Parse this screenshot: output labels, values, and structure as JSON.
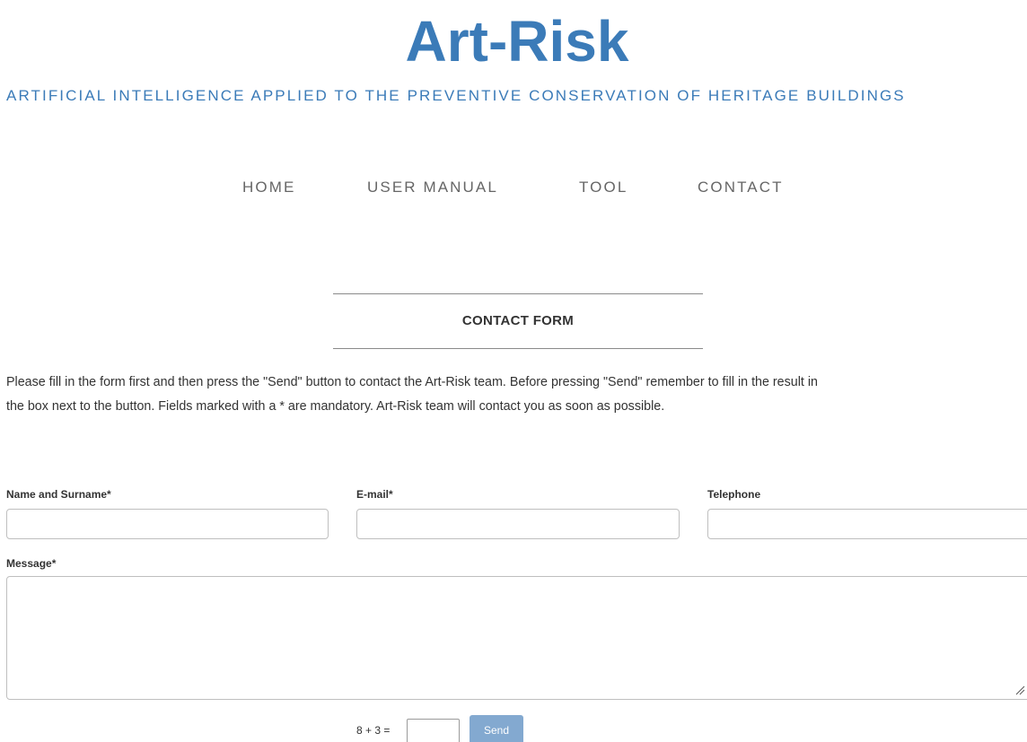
{
  "header": {
    "logo": "Art-Risk",
    "tagline": "ARTIFICIAL INTELLIGENCE APPLIED TO THE PREVENTIVE CONSERVATION OF HERITAGE BUILDINGS"
  },
  "nav": {
    "items": [
      {
        "label": "HOME"
      },
      {
        "label": "USER MANUAL"
      },
      {
        "label": "TOOL"
      },
      {
        "label": "CONTACT"
      }
    ]
  },
  "main": {
    "section_title": "CONTACT FORM",
    "intro_line1": "Please fill in the form first and then press the \"Send\" button to contact the Art-Risk team. Before pressing \"Send\" remember to fill in the result in",
    "intro_line2": "the box next to the button. Fields marked with a * are mandatory. Art-Risk team will contact you as soon as possible."
  },
  "form": {
    "name_label": "Name and Surname*",
    "name_value": "",
    "email_label": "E-mail*",
    "email_value": "",
    "phone_label": "Telephone",
    "phone_value": "",
    "message_label": "Message*",
    "message_value": "",
    "captcha_label": "8 + 3 =",
    "captcha_value": "",
    "send_label": "Send"
  },
  "colors": {
    "brand": "#3b7bb8",
    "nav_text": "#666666",
    "body_text": "#333333",
    "send_button": "#83a9d0",
    "input_border": "#bfbfbf"
  },
  "icons": {
    "textarea_resize": "resize-grip-icon"
  }
}
